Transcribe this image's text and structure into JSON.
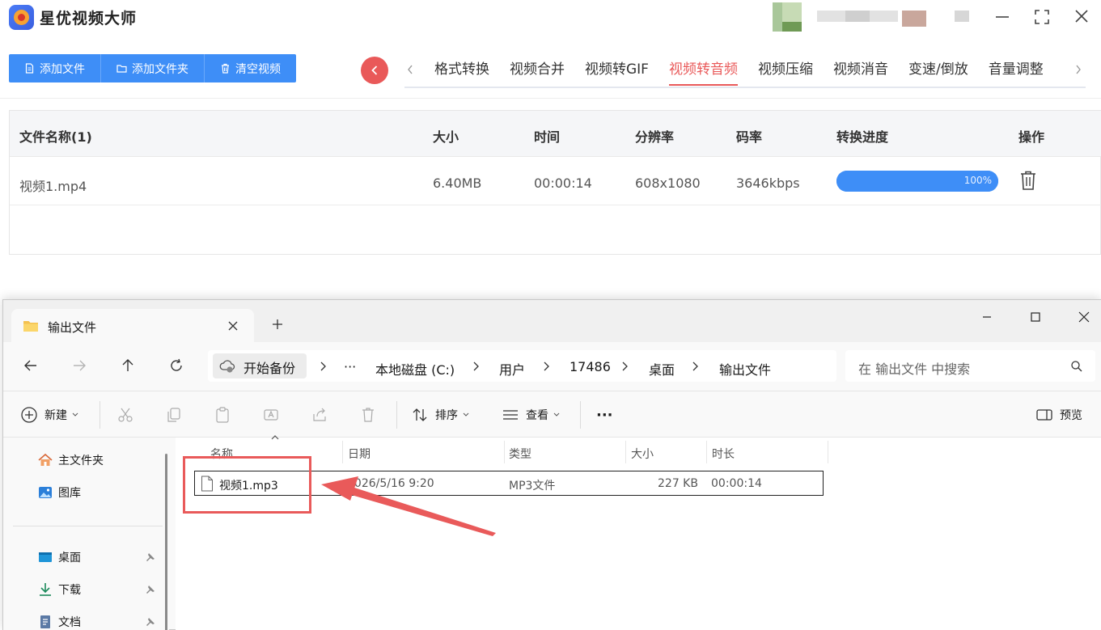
{
  "app": {
    "title": "星优视频大师",
    "toolbar": {
      "add_file": "添加文件",
      "add_folder": "添加文件夹",
      "clear_videos": "清空视频"
    },
    "tabs": [
      "格式转换",
      "视频合并",
      "视频转GIF",
      "视频转音频",
      "视频压缩",
      "视频消音",
      "变速/倒放",
      "音量调整"
    ],
    "active_tab": "视频转音频",
    "table": {
      "headers": {
        "name": "文件名称(1)",
        "size": "大小",
        "time": "时间",
        "resolution": "分辨率",
        "bitrate": "码率",
        "progress": "转换进度",
        "action": "操作"
      },
      "rows": [
        {
          "name": "视频1.mp4",
          "size": "6.40MB",
          "time": "00:00:14",
          "resolution": "608x1080",
          "bitrate": "3646kbps",
          "progress_label": "100%",
          "progress_value": 1.0
        }
      ]
    },
    "colors": {
      "accent_blue": "#3e8ef7",
      "accent_red": "#e95959"
    }
  },
  "explorer": {
    "tab_title": "输出文件",
    "breadcrumb": [
      "开始备份",
      "本地磁盘 (C:)",
      "用户",
      "17486",
      "桌面",
      "输出文件"
    ],
    "breadcrumb_more": "···",
    "search_placeholder": "在 输出文件 中搜索",
    "commands": {
      "new": "新建",
      "sort": "排序",
      "view": "查看",
      "more": "···",
      "preview": "预览"
    },
    "nav": [
      {
        "label": "主文件夹",
        "icon": "home-icon"
      },
      {
        "label": "图库",
        "icon": "gallery-icon"
      },
      {
        "label": "桌面",
        "icon": "desktop-icon",
        "pinned": true
      },
      {
        "label": "下载",
        "icon": "download-icon",
        "pinned": true
      },
      {
        "label": "文档",
        "icon": "document-icon",
        "pinned": true
      }
    ],
    "columns": {
      "name": "名称",
      "date": "日期",
      "type": "类型",
      "size": "大小",
      "duration": "时长"
    },
    "files": [
      {
        "name": "视频1.mp3",
        "date": "2026/5/16 9:20",
        "type": "MP3文件",
        "size": "227 KB",
        "duration": "00:00:14"
      }
    ]
  }
}
